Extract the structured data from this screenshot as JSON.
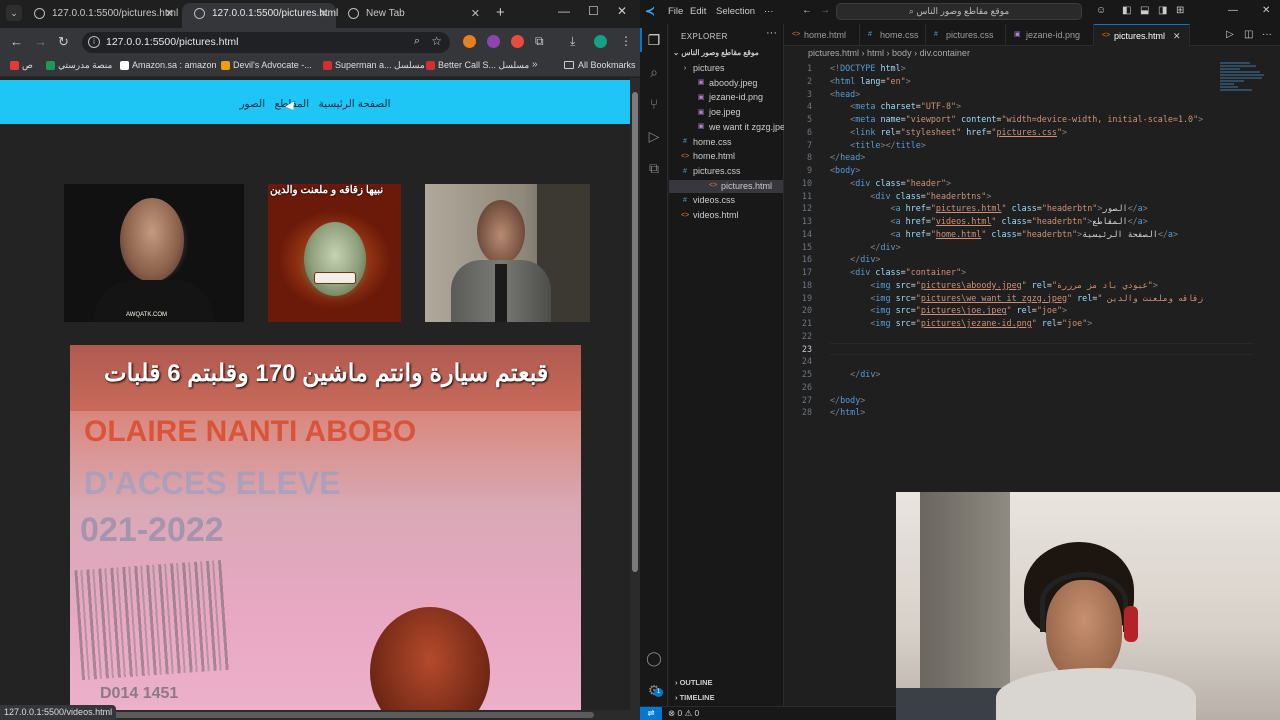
{
  "browser": {
    "tabs": [
      {
        "label": "127.0.0.1:5500/pictures.html",
        "active": false
      },
      {
        "label": "127.0.0.1:5500/pictures.html",
        "active": true
      },
      {
        "label": "New Tab",
        "active": false
      }
    ],
    "url": "127.0.0.1:5500/pictures.html",
    "bookmarks": [
      {
        "label": "ص",
        "color": "#e53935"
      },
      {
        "label": "منصة مدرستي",
        "color": "#1a9b59"
      },
      {
        "label": "Amazon.sa : amazon",
        "color": "#ffffff"
      },
      {
        "label": "Devil's Advocate -...",
        "color": "#f39c12"
      },
      {
        "label": "Superman a... مسلسل",
        "color": "#d32f2f"
      },
      {
        "label": "Better Call S... مسلسل",
        "color": "#d32f2f"
      }
    ],
    "all_bookmarks": "All Bookmarks",
    "status_url": "127.0.0.1:5500/videos.html"
  },
  "site": {
    "header_color": "#1ec6f5",
    "nav": [
      "الصفحة الرئيسية",
      "المقاطع",
      "الصور"
    ],
    "caption_joker": "نبيها زقاقه و ملعنت والدين",
    "watermark": "AWQATK.COM",
    "caption_card": "قبعتم سيارة وانتم ماشين 170 وقلبتم 6 قلبات",
    "card_line1": "OLAIRE NANTI ABOBO",
    "card_line2": "D'ACCES ELEVE",
    "card_line3": "021-2022",
    "card_line4": "D014    1451"
  },
  "vscode": {
    "menu": [
      "File",
      "Edit",
      "Selection"
    ],
    "search": "موقع مقاطع وصور الناس",
    "explorer_title": "EXPLORER",
    "root_folder": "موقع مقاطع وصور الناس",
    "tree": [
      {
        "label": "pictures",
        "type": "folder",
        "indent": 1
      },
      {
        "label": "aboody.jpeg",
        "type": "image",
        "indent": 2
      },
      {
        "label": "jezane-id.png",
        "type": "image",
        "indent": 2
      },
      {
        "label": "joe.jpeg",
        "type": "image",
        "indent": 2
      },
      {
        "label": "we want it zgzg.jpeg",
        "type": "image",
        "indent": 2
      },
      {
        "label": "home.css",
        "type": "css",
        "indent": 1
      },
      {
        "label": "home.html",
        "type": "html",
        "indent": 1
      },
      {
        "label": "pictures.css",
        "type": "css",
        "indent": 1
      },
      {
        "label": "pictures.html",
        "type": "html",
        "indent": 1,
        "selected": true
      },
      {
        "label": "videos.css",
        "type": "css",
        "indent": 1
      },
      {
        "label": "videos.html",
        "type": "html",
        "indent": 1
      }
    ],
    "outline": "OUTLINE",
    "timeline": "TIMELINE",
    "editor_tabs": [
      {
        "label": "home.html",
        "type": "html"
      },
      {
        "label": "home.css",
        "type": "css"
      },
      {
        "label": "pictures.css",
        "type": "css"
      },
      {
        "label": "jezane-id.png",
        "type": "image"
      },
      {
        "label": "pictures.html",
        "type": "html",
        "active": true
      }
    ],
    "breadcrumb": [
      "pictures.html",
      "html",
      "body",
      "div.container"
    ],
    "code_lines": [
      [
        [
          "t-punc",
          "<!"
        ],
        [
          "t-tag",
          "DOCTYPE"
        ],
        [
          "t-txt",
          " "
        ],
        [
          "t-attr",
          "html"
        ],
        [
          "t-punc",
          ">"
        ]
      ],
      [
        [
          "t-punc",
          "<"
        ],
        [
          "t-tag",
          "html"
        ],
        [
          "t-txt",
          " "
        ],
        [
          "t-attr",
          "lang"
        ],
        [
          "t-txt",
          "="
        ],
        [
          "t-str",
          "\"en\""
        ],
        [
          "t-punc",
          ">"
        ]
      ],
      [
        [
          "t-punc",
          "<"
        ],
        [
          "t-tag",
          "head"
        ],
        [
          "t-punc",
          ">"
        ]
      ],
      [
        [
          "t-txt",
          "    "
        ],
        [
          "t-punc",
          "<"
        ],
        [
          "t-tag",
          "meta"
        ],
        [
          "t-txt",
          " "
        ],
        [
          "t-attr",
          "charset"
        ],
        [
          "t-txt",
          "="
        ],
        [
          "t-str",
          "\"UTF-8\""
        ],
        [
          "t-punc",
          ">"
        ]
      ],
      [
        [
          "t-txt",
          "    "
        ],
        [
          "t-punc",
          "<"
        ],
        [
          "t-tag",
          "meta"
        ],
        [
          "t-txt",
          " "
        ],
        [
          "t-attr",
          "name"
        ],
        [
          "t-txt",
          "="
        ],
        [
          "t-str",
          "\"viewport\""
        ],
        [
          "t-txt",
          " "
        ],
        [
          "t-attr",
          "content"
        ],
        [
          "t-txt",
          "="
        ],
        [
          "t-str",
          "\"width=device-width, initial-scale=1.0\""
        ],
        [
          "t-punc",
          ">"
        ]
      ],
      [
        [
          "t-txt",
          "    "
        ],
        [
          "t-punc",
          "<"
        ],
        [
          "t-tag",
          "link"
        ],
        [
          "t-txt",
          " "
        ],
        [
          "t-attr",
          "rel"
        ],
        [
          "t-txt",
          "="
        ],
        [
          "t-str",
          "\"stylesheet\""
        ],
        [
          "t-txt",
          " "
        ],
        [
          "t-attr",
          "href"
        ],
        [
          "t-txt",
          "="
        ],
        [
          "t-str",
          "\""
        ],
        [
          "t-str-u",
          "pictures.css"
        ],
        [
          "t-str",
          "\""
        ],
        [
          "t-punc",
          ">"
        ]
      ],
      [
        [
          "t-txt",
          "    "
        ],
        [
          "t-punc",
          "<"
        ],
        [
          "t-tag",
          "title"
        ],
        [
          "t-punc",
          "></"
        ],
        [
          "t-tag",
          "title"
        ],
        [
          "t-punc",
          ">"
        ]
      ],
      [
        [
          "t-punc",
          "</"
        ],
        [
          "t-tag",
          "head"
        ],
        [
          "t-punc",
          ">"
        ]
      ],
      [
        [
          "t-punc",
          "<"
        ],
        [
          "t-tag",
          "body"
        ],
        [
          "t-punc",
          ">"
        ]
      ],
      [
        [
          "t-txt",
          "    "
        ],
        [
          "t-punc",
          "<"
        ],
        [
          "t-tag",
          "div"
        ],
        [
          "t-txt",
          " "
        ],
        [
          "t-attr",
          "class"
        ],
        [
          "t-txt",
          "="
        ],
        [
          "t-str",
          "\"header\""
        ],
        [
          "t-punc",
          ">"
        ]
      ],
      [
        [
          "t-txt",
          "        "
        ],
        [
          "t-punc",
          "<"
        ],
        [
          "t-tag",
          "div"
        ],
        [
          "t-txt",
          " "
        ],
        [
          "t-attr",
          "class"
        ],
        [
          "t-txt",
          "="
        ],
        [
          "t-str",
          "\"headerbtns\""
        ],
        [
          "t-punc",
          ">"
        ]
      ],
      [
        [
          "t-txt",
          "            "
        ],
        [
          "t-punc",
          "<"
        ],
        [
          "t-tag",
          "a"
        ],
        [
          "t-txt",
          " "
        ],
        [
          "t-attr",
          "href"
        ],
        [
          "t-txt",
          "="
        ],
        [
          "t-str",
          "\""
        ],
        [
          "t-str-u",
          "pictures.html"
        ],
        [
          "t-str",
          "\""
        ],
        [
          "t-txt",
          " "
        ],
        [
          "t-attr",
          "class"
        ],
        [
          "t-txt",
          "="
        ],
        [
          "t-str",
          "\"headerbtn\""
        ],
        [
          "t-punc",
          ">"
        ],
        [
          "t-txt",
          "الصور"
        ],
        [
          "t-punc",
          "</"
        ],
        [
          "t-tag",
          "a"
        ],
        [
          "t-punc",
          ">"
        ]
      ],
      [
        [
          "t-txt",
          "            "
        ],
        [
          "t-punc",
          "<"
        ],
        [
          "t-tag",
          "a"
        ],
        [
          "t-txt",
          " "
        ],
        [
          "t-attr",
          "href"
        ],
        [
          "t-txt",
          "="
        ],
        [
          "t-str",
          "\""
        ],
        [
          "t-str-u",
          "videos.html"
        ],
        [
          "t-str",
          "\""
        ],
        [
          "t-txt",
          " "
        ],
        [
          "t-attr",
          "class"
        ],
        [
          "t-txt",
          "="
        ],
        [
          "t-str",
          "\"headerbtn\""
        ],
        [
          "t-punc",
          ">"
        ],
        [
          "t-txt",
          "المقاطع"
        ],
        [
          "t-punc",
          "</"
        ],
        [
          "t-tag",
          "a"
        ],
        [
          "t-punc",
          ">"
        ]
      ],
      [
        [
          "t-txt",
          "            "
        ],
        [
          "t-punc",
          "<"
        ],
        [
          "t-tag",
          "a"
        ],
        [
          "t-txt",
          " "
        ],
        [
          "t-attr",
          "href"
        ],
        [
          "t-txt",
          "="
        ],
        [
          "t-str",
          "\""
        ],
        [
          "t-str-u",
          "home.html"
        ],
        [
          "t-str",
          "\""
        ],
        [
          "t-txt",
          " "
        ],
        [
          "t-attr",
          "class"
        ],
        [
          "t-txt",
          "="
        ],
        [
          "t-str",
          "\"headerbtn\""
        ],
        [
          "t-punc",
          ">"
        ],
        [
          "t-txt",
          "الصفحة الرئيسية"
        ],
        [
          "t-punc",
          "</"
        ],
        [
          "t-tag",
          "a"
        ],
        [
          "t-punc",
          ">"
        ]
      ],
      [
        [
          "t-txt",
          "        "
        ],
        [
          "t-punc",
          "</"
        ],
        [
          "t-tag",
          "div"
        ],
        [
          "t-punc",
          ">"
        ]
      ],
      [
        [
          "t-txt",
          "    "
        ],
        [
          "t-punc",
          "</"
        ],
        [
          "t-tag",
          "div"
        ],
        [
          "t-punc",
          ">"
        ]
      ],
      [
        [
          "t-txt",
          "    "
        ],
        [
          "t-punc",
          "<"
        ],
        [
          "t-tag",
          "div"
        ],
        [
          "t-txt",
          " "
        ],
        [
          "t-attr",
          "class"
        ],
        [
          "t-txt",
          "="
        ],
        [
          "t-str",
          "\"container\""
        ],
        [
          "t-punc",
          ">"
        ]
      ],
      [
        [
          "t-txt",
          "        "
        ],
        [
          "t-punc",
          "<"
        ],
        [
          "t-tag",
          "img"
        ],
        [
          "t-txt",
          " "
        ],
        [
          "t-attr",
          "src"
        ],
        [
          "t-txt",
          "="
        ],
        [
          "t-str",
          "\""
        ],
        [
          "t-str-u",
          "pictures\\aboody.jpeg"
        ],
        [
          "t-str",
          "\""
        ],
        [
          "t-txt",
          " "
        ],
        [
          "t-attr",
          "rel"
        ],
        [
          "t-txt",
          "="
        ],
        [
          "t-str",
          "\"عبودي باد مز مرررة\""
        ],
        [
          "t-punc",
          ">"
        ]
      ],
      [
        [
          "t-txt",
          "        "
        ],
        [
          "t-punc",
          "<"
        ],
        [
          "t-tag",
          "img"
        ],
        [
          "t-txt",
          " "
        ],
        [
          "t-attr",
          "src"
        ],
        [
          "t-txt",
          "="
        ],
        [
          "t-str",
          "\""
        ],
        [
          "t-str-u",
          "pictures\\we want it zgzg.jpeg"
        ],
        [
          "t-str",
          "\""
        ],
        [
          "t-txt",
          " "
        ],
        [
          "t-attr",
          "rel"
        ],
        [
          "t-txt",
          "="
        ],
        [
          "t-str",
          "\" زقاقه وملعنت والدين"
        ]
      ],
      [
        [
          "t-txt",
          "        "
        ],
        [
          "t-punc",
          "<"
        ],
        [
          "t-tag",
          "img"
        ],
        [
          "t-txt",
          " "
        ],
        [
          "t-attr",
          "src"
        ],
        [
          "t-txt",
          "="
        ],
        [
          "t-str",
          "\""
        ],
        [
          "t-str-u",
          "pictures\\joe.jpeg"
        ],
        [
          "t-str",
          "\""
        ],
        [
          "t-txt",
          " "
        ],
        [
          "t-attr",
          "rel"
        ],
        [
          "t-txt",
          "="
        ],
        [
          "t-str",
          "\"joe\""
        ],
        [
          "t-punc",
          ">"
        ]
      ],
      [
        [
          "t-txt",
          "        "
        ],
        [
          "t-punc",
          "<"
        ],
        [
          "t-tag",
          "img"
        ],
        [
          "t-txt",
          " "
        ],
        [
          "t-attr",
          "src"
        ],
        [
          "t-txt",
          "="
        ],
        [
          "t-str",
          "\""
        ],
        [
          "t-str-u",
          "pictures\\jezane-id.png"
        ],
        [
          "t-str",
          "\""
        ],
        [
          "t-txt",
          " "
        ],
        [
          "t-attr",
          "rel"
        ],
        [
          "t-txt",
          "="
        ],
        [
          "t-str",
          "\"joe\""
        ],
        [
          "t-punc",
          ">"
        ]
      ],
      [],
      [],
      [],
      [
        [
          "t-txt",
          "    "
        ],
        [
          "t-punc",
          "</"
        ],
        [
          "t-tag",
          "div"
        ],
        [
          "t-punc",
          ">"
        ]
      ],
      [],
      [
        [
          "t-punc",
          "</"
        ],
        [
          "t-tag",
          "body"
        ],
        [
          "t-punc",
          ">"
        ]
      ],
      [
        [
          "t-punc",
          "</"
        ],
        [
          "t-tag",
          "html"
        ],
        [
          "t-punc",
          ">"
        ]
      ]
    ],
    "current_line": 23,
    "status": "⊗ 0 ⚠ 0"
  }
}
